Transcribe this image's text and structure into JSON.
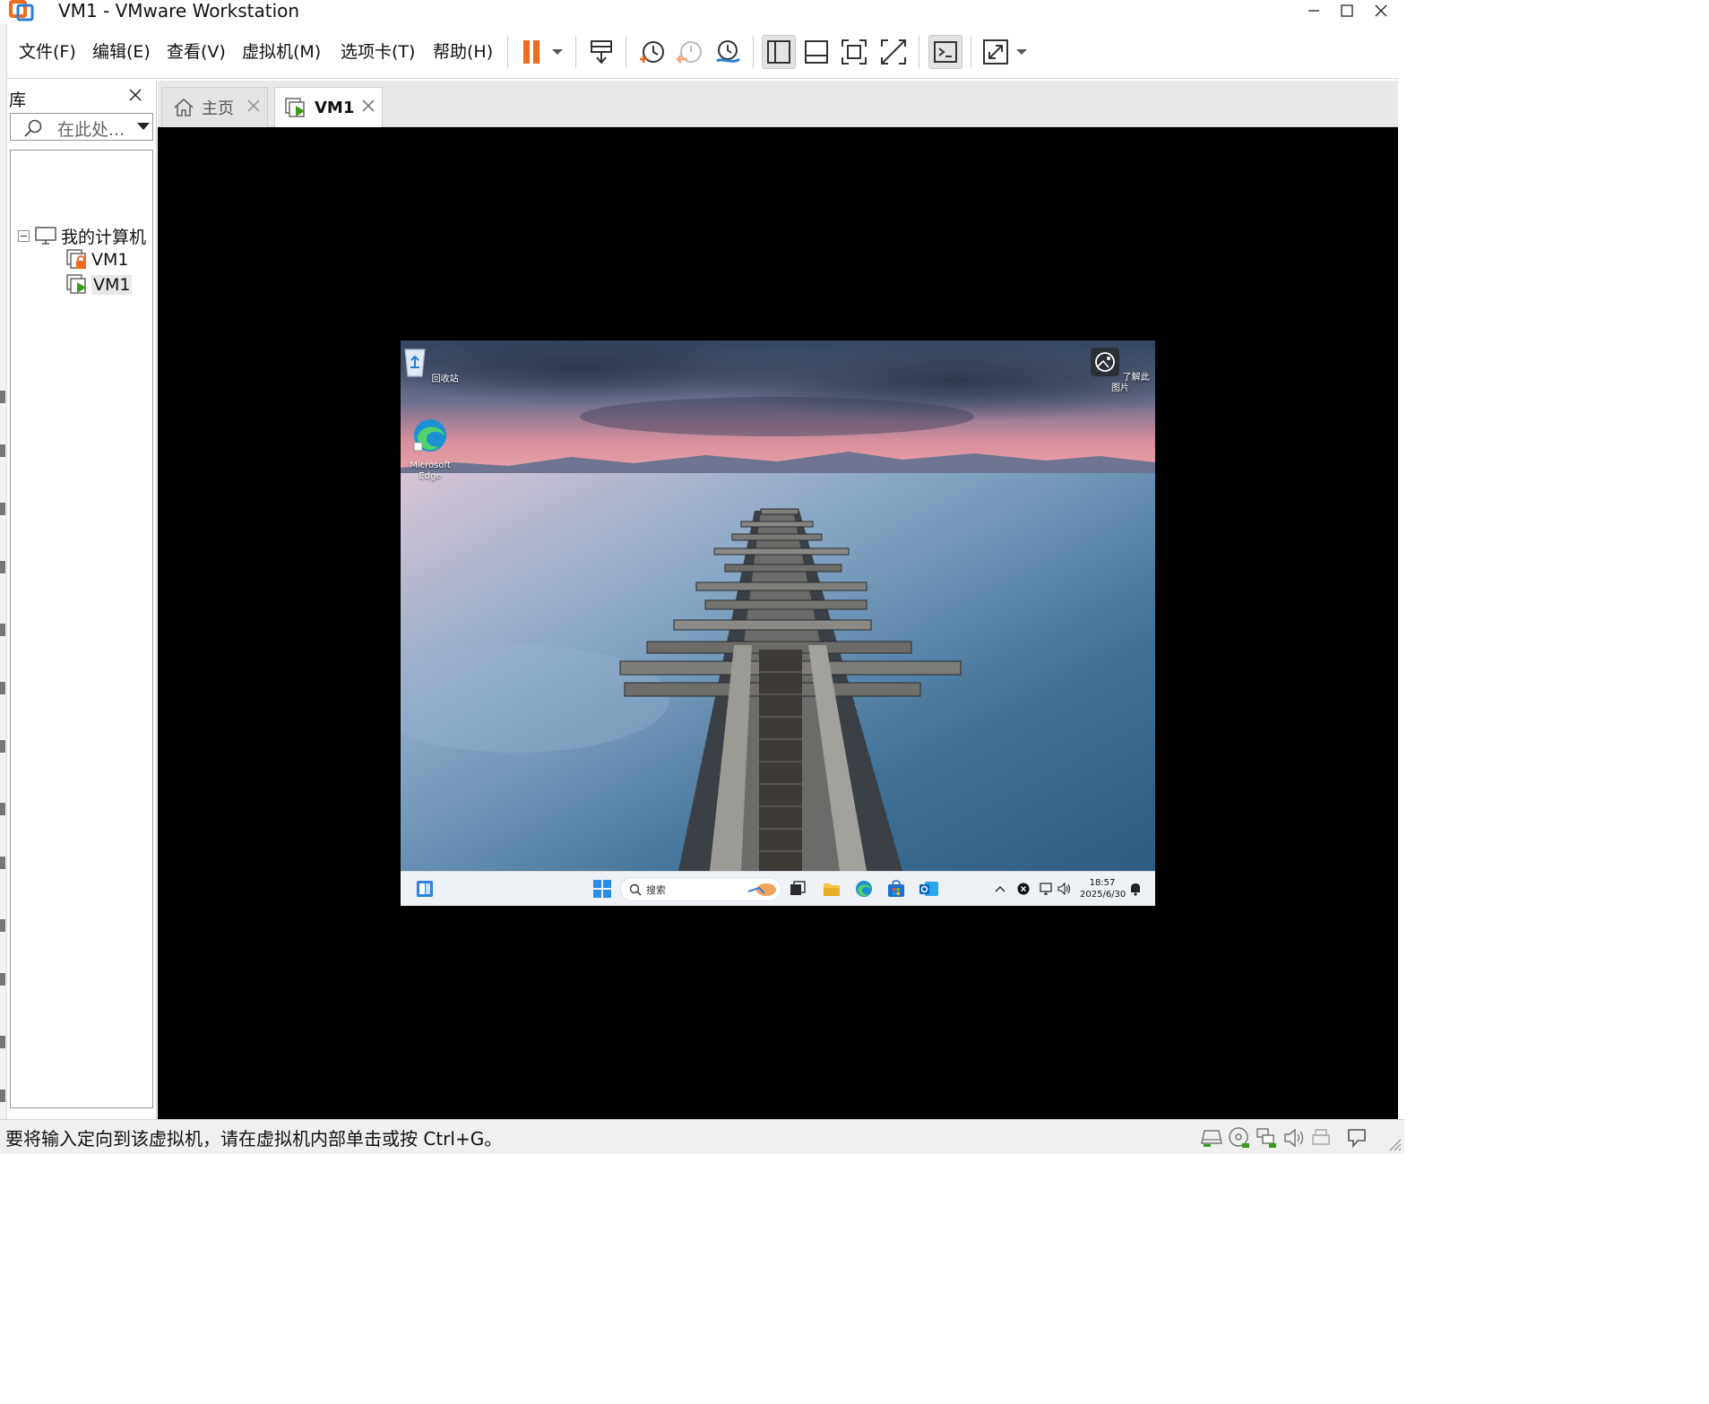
{
  "window": {
    "title": "VM1 - VMware Workstation",
    "controls": [
      "minimize",
      "maximize",
      "close"
    ]
  },
  "menu": {
    "items": [
      "文件(F)",
      "编辑(E)",
      "查看(V)",
      "虚拟机(M)",
      "选项卡(T)",
      "帮助(H)"
    ]
  },
  "toolbar": {
    "icons": [
      "pause-icon",
      "dropdown-arrow-icon",
      "send-ctrl-alt-del-icon",
      "snapshot-take-icon",
      "snapshot-revert-icon",
      "snapshot-manager-icon",
      "view-sidebar-icon",
      "view-thumbnail-icon",
      "fullscreen-icon",
      "unity-icon",
      "console-icon",
      "stretch-guest-icon",
      "dropdown-arrow-icon"
    ],
    "pause_color": "#f26b1d"
  },
  "library": {
    "title": "库",
    "search_placeholder": "在此处...",
    "tree": {
      "root": "我的计算机",
      "children": [
        {
          "label": "VM1",
          "state": "locked"
        },
        {
          "label": "VM1",
          "state": "running",
          "selected": true
        }
      ]
    }
  },
  "tabs": [
    {
      "label": "主页",
      "icon": "home-icon",
      "active": false
    },
    {
      "label": "VM1",
      "icon": "vm-running-icon",
      "active": true
    }
  ],
  "guest": {
    "desktop_icons": [
      {
        "label": "回收站",
        "icon": "recycle-bin-icon"
      },
      {
        "label": "Microsoft Edge",
        "icon": "edge-icon"
      },
      {
        "label": "了解此图片",
        "icon": "learn-about-picture-icon"
      }
    ],
    "taskbar": {
      "search_placeholder": "搜索",
      "apps": [
        "widgets-icon",
        "start-icon",
        "task-view-icon",
        "file-explorer-icon",
        "edge-icon",
        "store-icon",
        "outlook-icon"
      ],
      "tray": [
        "chevron-up-icon",
        "close-circle-icon",
        "network-icon",
        "volume-icon",
        "notification-icon"
      ],
      "time": "18:57",
      "date": "2025/6/30"
    }
  },
  "status": {
    "message": "要将输入定向到该虚拟机，请在虚拟机内部单击或按 Ctrl+G。",
    "device_icons": [
      "hard-disk-icon",
      "cd-dvd-icon",
      "network-adapter-icon",
      "sound-card-icon",
      "printer-icon",
      "message-log-icon"
    ]
  },
  "colors": {
    "accent_orange": "#f26b1d",
    "console_bg": "#000000",
    "vm_running_green": "#3a9b1a"
  }
}
